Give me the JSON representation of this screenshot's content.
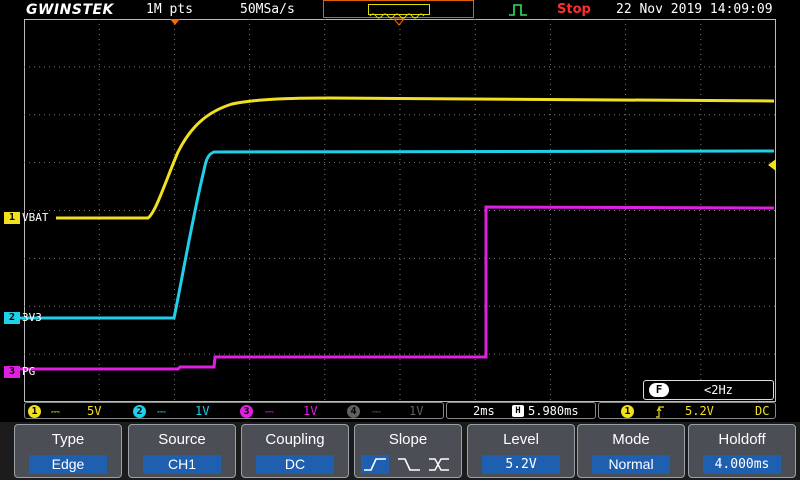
{
  "header": {
    "logo": "GWINSTEK",
    "record_length": "1M pts",
    "sample_rate": "50MSa/s",
    "run_state": "Stop",
    "datetime": "22 Nov 2019 14:09:09"
  },
  "colors": {
    "ch1": "#f0e020",
    "ch2": "#20d0e8",
    "ch3": "#e020e0",
    "ch4": "#606060",
    "trigger_marker": "#ff6a00",
    "menu_value_bg": "#1f5fb0"
  },
  "channels": [
    {
      "num": "1",
      "label": "VBAT"
    },
    {
      "num": "2",
      "label": "3V3"
    },
    {
      "num": "3",
      "label": "PG"
    }
  ],
  "trigger_freq": {
    "icon": "F",
    "value": "<2Hz"
  },
  "status": {
    "ch1": {
      "num": "1",
      "scale": "5V"
    },
    "ch2": {
      "num": "2",
      "scale": "1V"
    },
    "ch3": {
      "num": "3",
      "scale": "1V"
    },
    "ch4": {
      "num": "4",
      "scale": "1V"
    },
    "timebase": "2ms",
    "position": "5.980ms",
    "trigger": {
      "source_num": "1",
      "level": "5.2V",
      "coupling": "DC"
    }
  },
  "menu": {
    "type": {
      "title": "Type",
      "value": "Edge"
    },
    "source": {
      "title": "Source",
      "value": "CH1"
    },
    "coupling": {
      "title": "Coupling",
      "value": "DC"
    },
    "slope": {
      "title": "Slope",
      "options": [
        "rising",
        "falling",
        "either"
      ],
      "selected": "rising"
    },
    "level": {
      "title": "Level",
      "value": "5.2V"
    },
    "mode": {
      "title": "Mode",
      "value": "Normal"
    },
    "holdoff": {
      "title": "Holdoff",
      "value": "4.000ms"
    }
  }
}
